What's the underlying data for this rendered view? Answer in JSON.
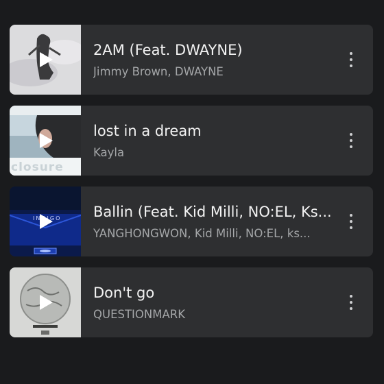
{
  "tracks": [
    {
      "title": "2AM (Feat. DWAYNE)",
      "artist": "Jimmy Brown, DWAYNE",
      "art_text": ""
    },
    {
      "title": "lost in a dream",
      "artist": "Kayla",
      "art_text": "closure"
    },
    {
      "title": "Ballin (Feat. Kid Milli, NO:EL, Ks...",
      "artist": "YANGHONGWON, Kid Milli, NO:EL, ks...",
      "art_text": "INDIGO"
    },
    {
      "title": "Don't go",
      "artist": "QUESTIONMARK",
      "art_text": ""
    }
  ],
  "icons": {
    "play": "play-icon",
    "more": "more-vert-icon"
  },
  "colors": {
    "background": "#1a1b1d",
    "card": "#2e2f31",
    "title": "#f2f2f2",
    "artist": "#a4a6a8"
  }
}
